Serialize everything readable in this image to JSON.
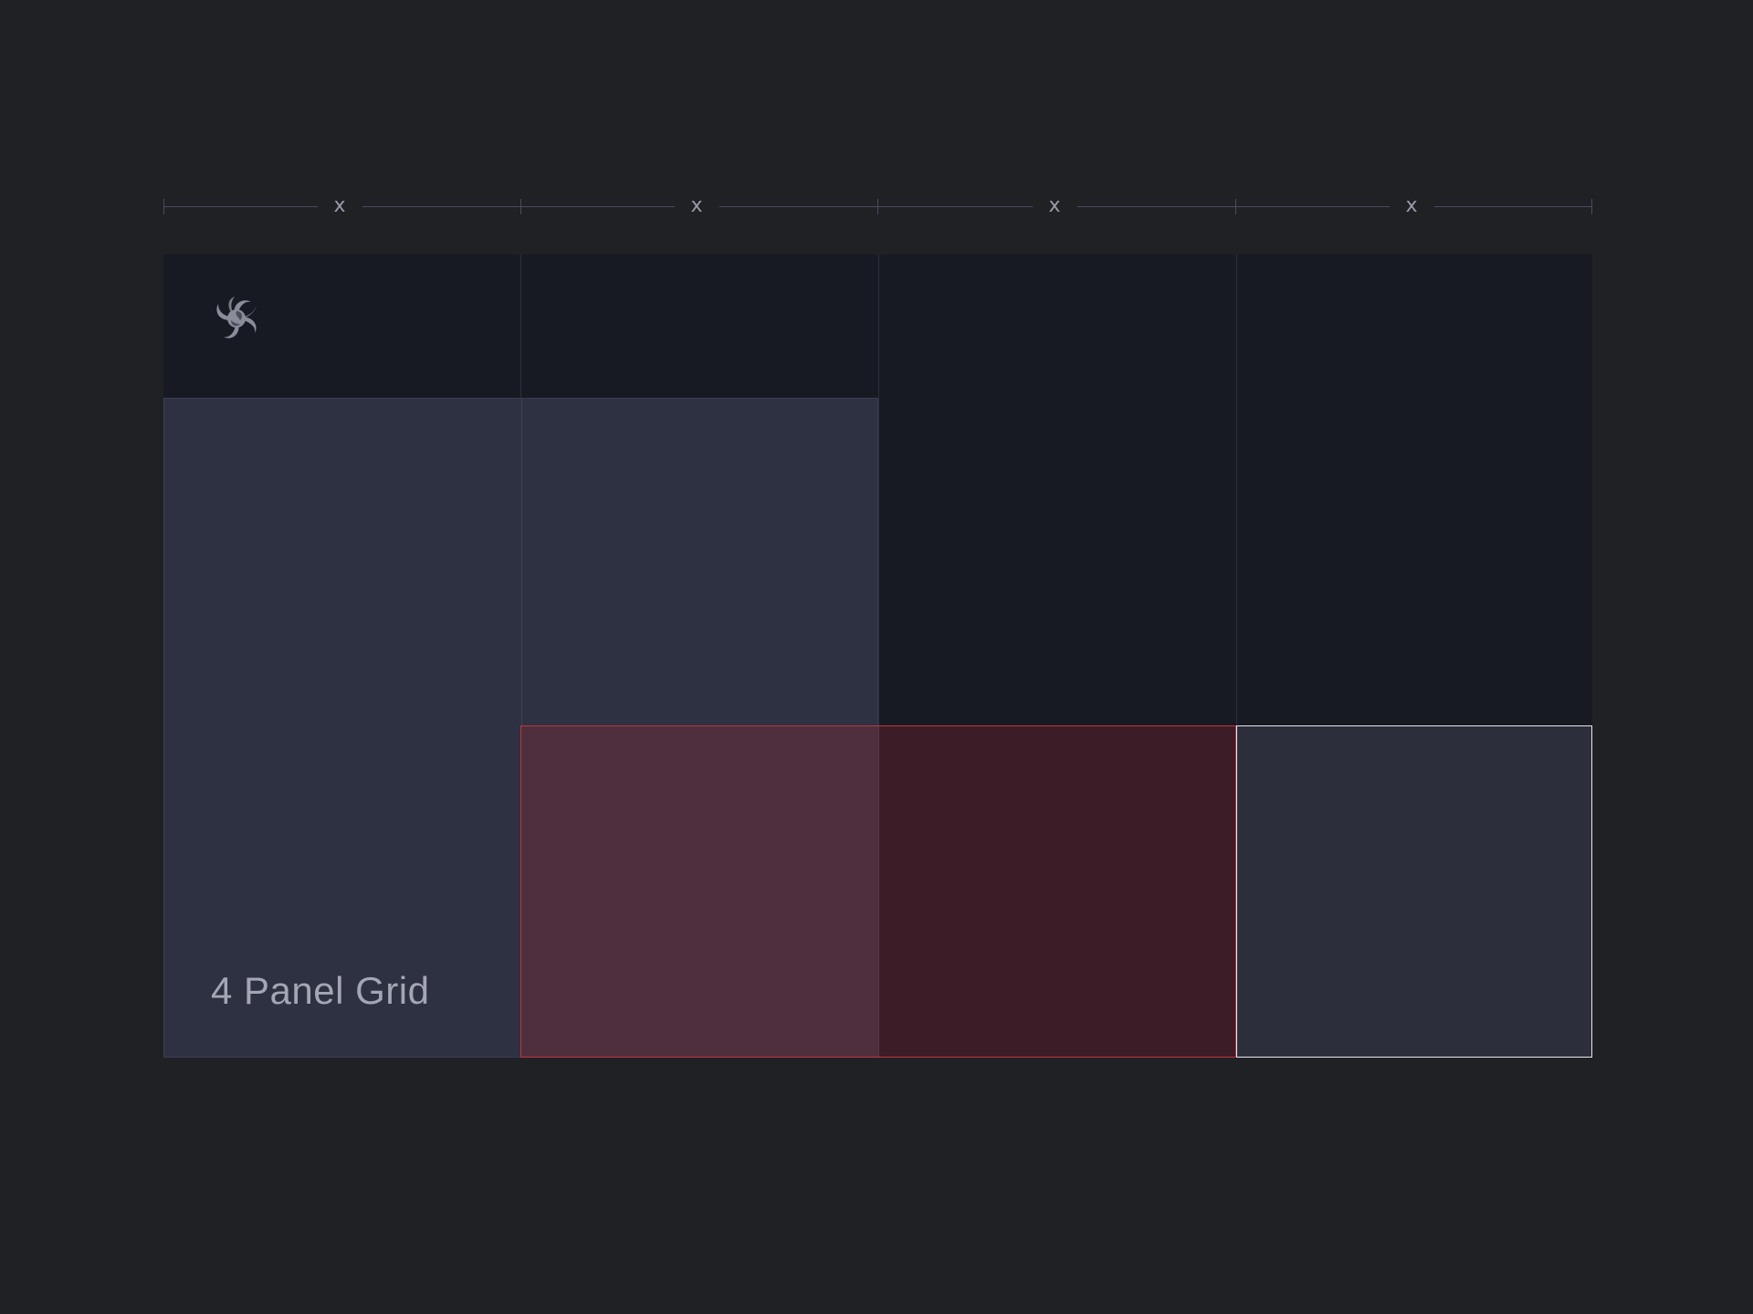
{
  "measure": {
    "segments": [
      {
        "label": "x"
      },
      {
        "label": "x"
      },
      {
        "label": "x"
      },
      {
        "label": "x"
      }
    ]
  },
  "grid": {
    "title": "4 Panel Grid",
    "columns": 4,
    "logo_icon": "swirl-logo-icon"
  },
  "colors": {
    "background": "#202125",
    "canvas": "#171a23",
    "panel_primary": "#2e3142",
    "panel_highlight_border": "#c2363e",
    "panel_highlight_fill": "#3c1c27",
    "panel_selected_border": "#e6e6ec",
    "panel_selected_fill": "#2c2e3b",
    "text_muted": "#a4a6b4"
  }
}
